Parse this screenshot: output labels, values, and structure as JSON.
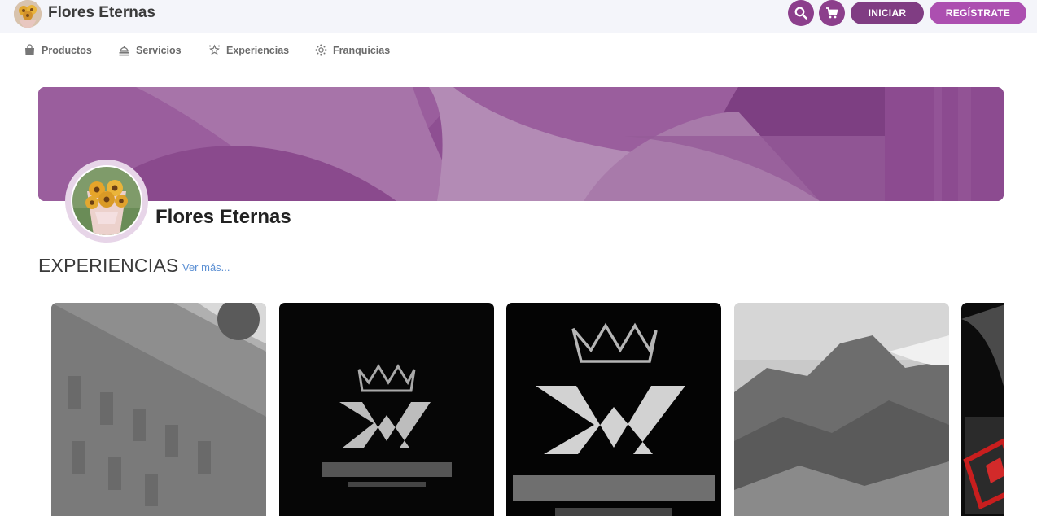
{
  "header": {
    "brand_title": "Flores Eternas",
    "login_label": "INICIAR",
    "register_label": "REGÍSTRATE",
    "accent_color": "#8c3f8c"
  },
  "nav": {
    "items": [
      {
        "label": "Productos",
        "icon": "shopping-bag-icon"
      },
      {
        "label": "Servicios",
        "icon": "services-icon"
      },
      {
        "label": "Experiencias",
        "icon": "experiences-icon"
      },
      {
        "label": "Franquicias",
        "icon": "franchise-icon"
      }
    ]
  },
  "profile": {
    "name": "Flores Eternas"
  },
  "section": {
    "title": "EXPERIENCIAS",
    "see_more": "Ver más..."
  },
  "cards": [
    {
      "image": "building-photo"
    },
    {
      "image": "expo-riverista-logo"
    },
    {
      "image": "expo-riverista-logo"
    },
    {
      "image": "mountain-photo"
    },
    {
      "image": "red-stamp-photo"
    }
  ]
}
